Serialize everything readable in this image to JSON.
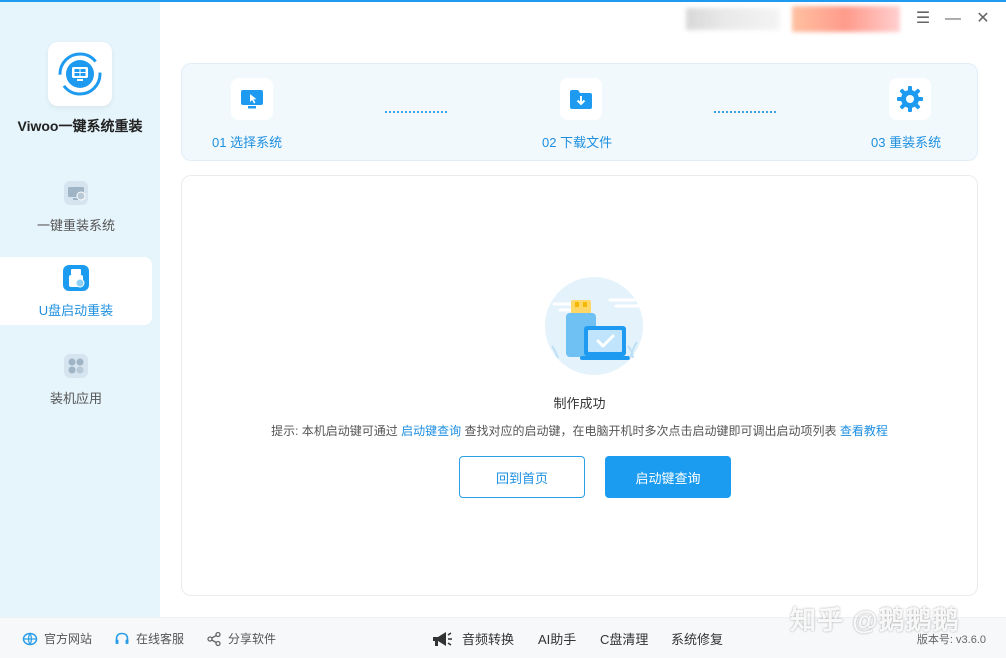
{
  "app": {
    "name": "Viwoo一键系统重装"
  },
  "sidebar": {
    "items": [
      {
        "label": "一键重装系统",
        "icon": "monitor-reinstall-icon",
        "active": false
      },
      {
        "label": "U盘启动重装",
        "icon": "usb-drive-icon",
        "active": true
      },
      {
        "label": "装机应用",
        "icon": "apps-grid-icon",
        "active": false
      }
    ]
  },
  "window_controls": {
    "menu": "☰",
    "minimize": "—",
    "close": "✕"
  },
  "steps": [
    {
      "label": "01 选择系统",
      "icon": "monitor-cursor-icon"
    },
    {
      "label": "02 下载文件",
      "icon": "folder-download-icon"
    },
    {
      "label": "03 重装系统",
      "icon": "gear-icon"
    }
  ],
  "main": {
    "success_text": "制作成功",
    "hint": {
      "prefix": "提示: 本机启动键可通过 ",
      "link1": "启动键查询",
      "middle": " 查找对应的启动键，在电脑开机时多次点击启动键即可调出启动项列表 ",
      "link2": "查看教程"
    },
    "buttons": {
      "home": "回到首页",
      "boot_key_query": "启动键查询"
    }
  },
  "footer": {
    "links": [
      {
        "label": "官方网站",
        "icon": "globe-icon"
      },
      {
        "label": "在线客服",
        "icon": "headset-icon"
      },
      {
        "label": "分享软件",
        "icon": "share-icon"
      }
    ],
    "tools": [
      {
        "label": "音频转换",
        "icon": "megaphone-icon"
      },
      {
        "label": "AI助手"
      },
      {
        "label": "C盘清理"
      },
      {
        "label": "系统修复"
      }
    ],
    "version": "版本号: v3.6.0"
  },
  "watermark": "知乎 @鹅鹅鹅",
  "colors": {
    "accent": "#1c9cf0",
    "sidebar_bg": "#e6f4fc",
    "link": "#1e8fe0"
  }
}
